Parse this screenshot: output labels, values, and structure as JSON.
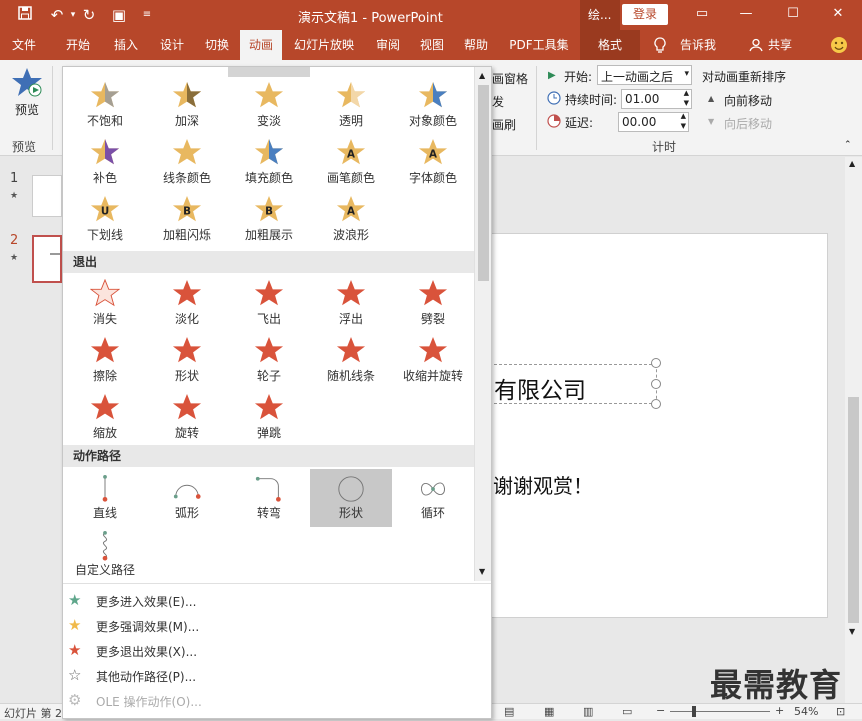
{
  "app": {
    "title": "演示文稿1 - PowerPoint",
    "context_tab_short": "绘...",
    "login_label": "登录"
  },
  "ribbon_tabs": [
    "文件",
    "开始",
    "插入",
    "设计",
    "切换",
    "动画",
    "幻灯片放映",
    "审阅",
    "视图",
    "帮助",
    "PDF工具集",
    "格式"
  ],
  "tell_me": "告诉我",
  "share": "共享",
  "ribbon": {
    "preview_label": "预览",
    "preview_group": "预览",
    "anim_pane": "画窗格",
    "trigger": "发",
    "painter": "画刷",
    "start_label": "开始:",
    "start_value": "上一动画之后",
    "duration_label": "持续时间:",
    "duration_value": "01.00",
    "delay_label": "延迟:",
    "delay_value": "00.00",
    "timing_group": "计时",
    "reorder_title": "对动画重新排序",
    "move_earlier": "向前移动",
    "move_later": "向后移动"
  },
  "slides": [
    {
      "num": "1",
      "star": "★"
    },
    {
      "num": "2",
      "star": "★"
    }
  ],
  "slide_content": {
    "company": "有限公司",
    "thanks": "谢谢观赏！"
  },
  "gallery": {
    "emphasis_items": [
      {
        "label": "不饱和",
        "icon": "star-desaturate"
      },
      {
        "label": "加深",
        "icon": "star-darken"
      },
      {
        "label": "变淡",
        "icon": "star-lighten"
      },
      {
        "label": "透明",
        "icon": "star-transparency"
      },
      {
        "label": "对象颜色",
        "icon": "star-object-color"
      },
      {
        "label": "补色",
        "icon": "star-complementary"
      },
      {
        "label": "线条颜色",
        "icon": "star-line-color"
      },
      {
        "label": "填充颜色",
        "icon": "star-fill-color"
      },
      {
        "label": "画笔颜色",
        "icon": "star-brush-color"
      },
      {
        "label": "字体颜色",
        "icon": "star-font-color"
      },
      {
        "label": "下划线",
        "icon": "star-underline"
      },
      {
        "label": "加粗闪烁",
        "icon": "star-bold-flash"
      },
      {
        "label": "加粗展示",
        "icon": "star-bold-reveal"
      },
      {
        "label": "波浪形",
        "icon": "star-wave"
      }
    ],
    "exit_title": "退出",
    "exit_items": [
      {
        "label": "消失",
        "icon": "star-disappear"
      },
      {
        "label": "淡化",
        "icon": "star-fade"
      },
      {
        "label": "飞出",
        "icon": "star-fly-out"
      },
      {
        "label": "浮出",
        "icon": "star-float-out"
      },
      {
        "label": "劈裂",
        "icon": "star-split"
      },
      {
        "label": "擦除",
        "icon": "star-wipe"
      },
      {
        "label": "形状",
        "icon": "star-shape"
      },
      {
        "label": "轮子",
        "icon": "star-wheel"
      },
      {
        "label": "随机线条",
        "icon": "star-random-bars"
      },
      {
        "label": "收缩并旋转",
        "icon": "star-shrink-turn"
      },
      {
        "label": "缩放",
        "icon": "star-zoom"
      },
      {
        "label": "旋转",
        "icon": "star-swivel"
      },
      {
        "label": "弹跳",
        "icon": "star-bounce"
      }
    ],
    "path_title": "动作路径",
    "path_items": [
      {
        "label": "直线",
        "icon": "path-line"
      },
      {
        "label": "弧形",
        "icon": "path-arc"
      },
      {
        "label": "转弯",
        "icon": "path-turn"
      },
      {
        "label": "形状",
        "icon": "path-shape"
      },
      {
        "label": "循环",
        "icon": "path-loop"
      },
      {
        "label": "自定义路径",
        "icon": "path-custom"
      }
    ],
    "selected_path": 3
  },
  "footer_items": [
    {
      "label": "更多进入效果(E)...",
      "icon": "star-green-icon",
      "color": "#5fa68b",
      "enabled": true
    },
    {
      "label": "更多强调效果(M)...",
      "icon": "star-yellow-icon",
      "color": "#f0b94a",
      "enabled": true
    },
    {
      "label": "更多退出效果(X)...",
      "icon": "star-red-icon",
      "color": "#d9533b",
      "enabled": true
    },
    {
      "label": "其他动作路径(P)...",
      "icon": "star-outline-icon",
      "color": "#666666",
      "enabled": true
    },
    {
      "label": "OLE 操作动作(O)...",
      "icon": "gear-icon",
      "color": "#bbbbbb",
      "enabled": false
    }
  ],
  "status": {
    "slide_label": "幻灯片 第 2",
    "zoom": "54%"
  },
  "watermark": "最需教育",
  "colors": {
    "accent": "#b7472a",
    "emphasis_star": "#e8b860",
    "exit_star": "#d9533b",
    "path_green": "#6a9e8a",
    "path_red": "#d9533b"
  }
}
